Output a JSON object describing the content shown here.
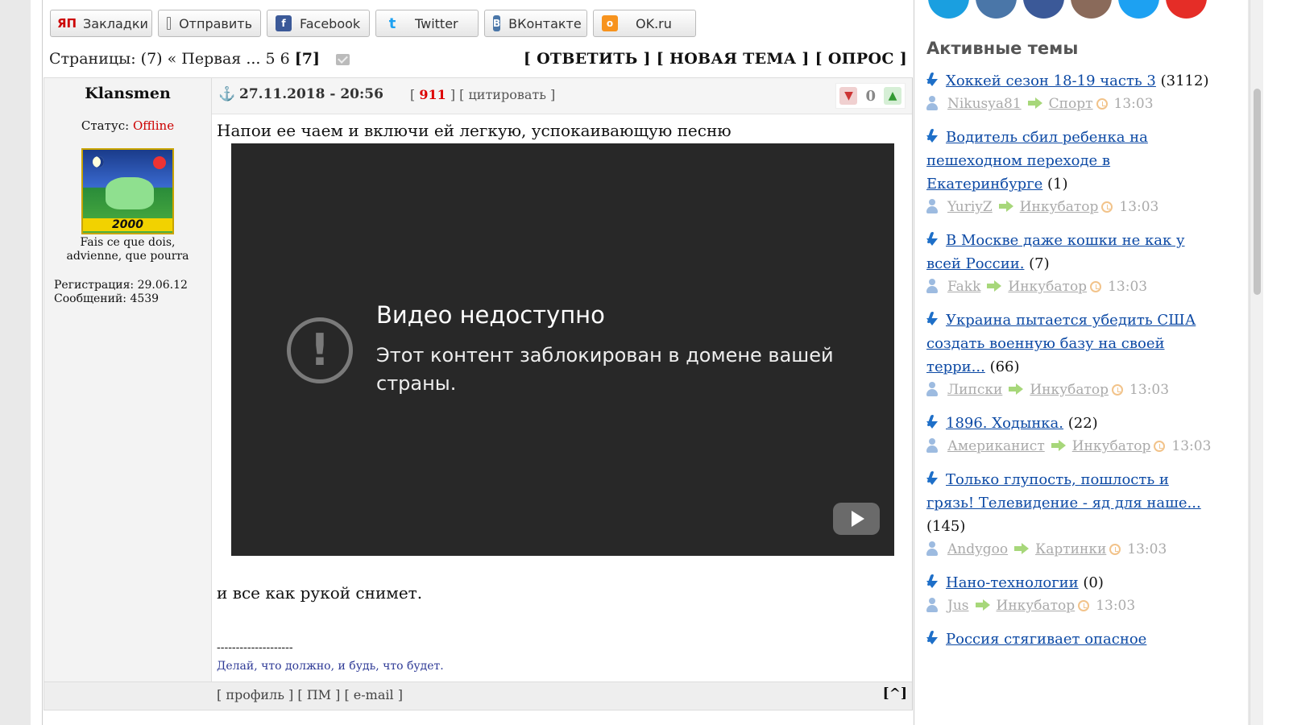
{
  "share": {
    "buttons": [
      {
        "label": "Закладки",
        "icon": "ya-icon",
        "color": "#cc0000"
      },
      {
        "label": "Отправить",
        "icon": "mail-icon",
        "color": "#888888"
      },
      {
        "label": "Facebook",
        "icon": "facebook-icon",
        "color": "#3b5998"
      },
      {
        "label": "Twitter",
        "icon": "twitter-icon",
        "color": "#1da1f2"
      },
      {
        "label": "ВКонтакте",
        "icon": "vk-icon",
        "color": "#4a76a8"
      },
      {
        "label": "OK.ru",
        "icon": "ok-icon",
        "color": "#f7931e"
      }
    ]
  },
  "pagination": {
    "label": "Страницы:",
    "count": "(7)",
    "first": "« Первая",
    "ellipsis": "...",
    "p5": "5",
    "p6": "6",
    "current": "[7]"
  },
  "actions": {
    "reply": "[ ОТВЕТИТЬ ]",
    "new_topic": "[ НОВАЯ ТЕМА ]",
    "poll": "[ ОПРОС ]"
  },
  "post": {
    "author": "Klansmen",
    "status_label": "Статус:",
    "status_value": "Offline",
    "avatar_year": "2000",
    "motto_line1": "Fais ce que dois,",
    "motto_line2": "advienne, que pourra",
    "registration": "Регистрация: 29.06.12",
    "messages": "Сообщений: 4539",
    "date": "27.11.2018 - 20:56",
    "number": "911",
    "quote": "цитировать",
    "rating": "0",
    "text1": "Напои ее чаем и включи ей легкую, успокаивающую песню",
    "video_title": "Видео недоступно",
    "video_message": "Этот контент заблокирован в домене вашей страны.",
    "text2": "и все как рукой снимет.",
    "sig_line": "--------------------",
    "signature": "Делай, что должно, и будь, что будет.",
    "foot_profile": "профиль",
    "foot_pm": "ПМ",
    "foot_email": "e-mail",
    "to_top": "[^]"
  },
  "sidebar": {
    "title": "Активные темы",
    "social_colors": [
      "#1a9fe0",
      "#4a76a8",
      "#3b5998",
      "#8a6a5a",
      "#1da1f2",
      "#e52d27"
    ],
    "topics": [
      {
        "title": "Хоккей сезон 18-19 часть 3",
        "count": "(3112)",
        "user": "Nikusya81",
        "category": "Спорт",
        "time": "13:03"
      },
      {
        "title": "Водитель сбил ребенка на пешеходном переходе в Екатеринбурге",
        "count": "(1)",
        "user": "YuriyZ",
        "category": "Инкубатор",
        "time": "13:03"
      },
      {
        "title": "В Москве даже кошки не как у всей России.",
        "count": "(7)",
        "user": "Fakk",
        "category": "Инкубатор",
        "time": "13:03"
      },
      {
        "title": "Украина пытается убедить США создать военную базу на своей терри...",
        "count": "(66)",
        "user": "Липски",
        "category": "Инкубатор",
        "time": "13:03"
      },
      {
        "title": "1896. Ходынка.",
        "count": "(22)",
        "user": "Американист",
        "category": "Инкубатор",
        "time": "13:03"
      },
      {
        "title": "Только глупость, пошлость и грязь! Телевидение - яд для наше...",
        "count": "(145)",
        "user": "Andygoo",
        "category": "Картинки",
        "time": "13:03"
      },
      {
        "title": "Нано-технологии",
        "count": "(0)",
        "user": "Jus",
        "category": "Инкубатор",
        "time": "13:03"
      },
      {
        "title": "Россия стягивает опасное",
        "count": "",
        "user": "",
        "category": "",
        "time": ""
      }
    ]
  }
}
